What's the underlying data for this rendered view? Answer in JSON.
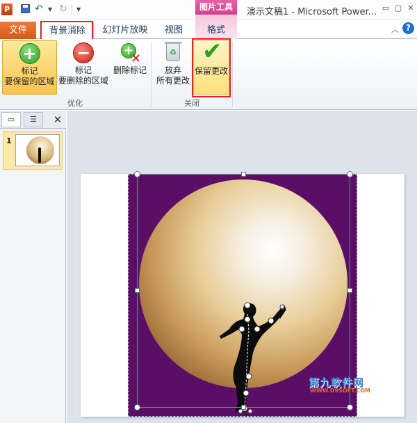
{
  "window": {
    "title": "演示文稿1 - Microsoft Power...",
    "app_icon_letter": "P",
    "context_tab_group": "图片工具"
  },
  "tabs": {
    "file": "文件",
    "background_removal": "背景消除",
    "slideshow": "幻灯片放映",
    "view": "视图",
    "format": "格式"
  },
  "ribbon": {
    "groups": {
      "refine": "优化",
      "close": "关闭"
    },
    "buttons": {
      "mark_keep_line1": "标记",
      "mark_keep_line2": "要保留的区域",
      "mark_remove_line1": "标记",
      "mark_remove_line2": "要删除的区域",
      "delete_mark": "删除标记",
      "discard_line1": "放弃",
      "discard_line2": "所有更改",
      "keep_changes": "保留更改"
    }
  },
  "left_panel": {
    "slide_number": "1"
  },
  "watermark": {
    "text": "第九软件网",
    "url": "WWW.D9SOFT.COM"
  },
  "colors": {
    "highlight_box": "#e0202a",
    "photo_background": "#5b0e66",
    "file_tab": "#e06a20",
    "context_tab": "#d43e8c"
  }
}
